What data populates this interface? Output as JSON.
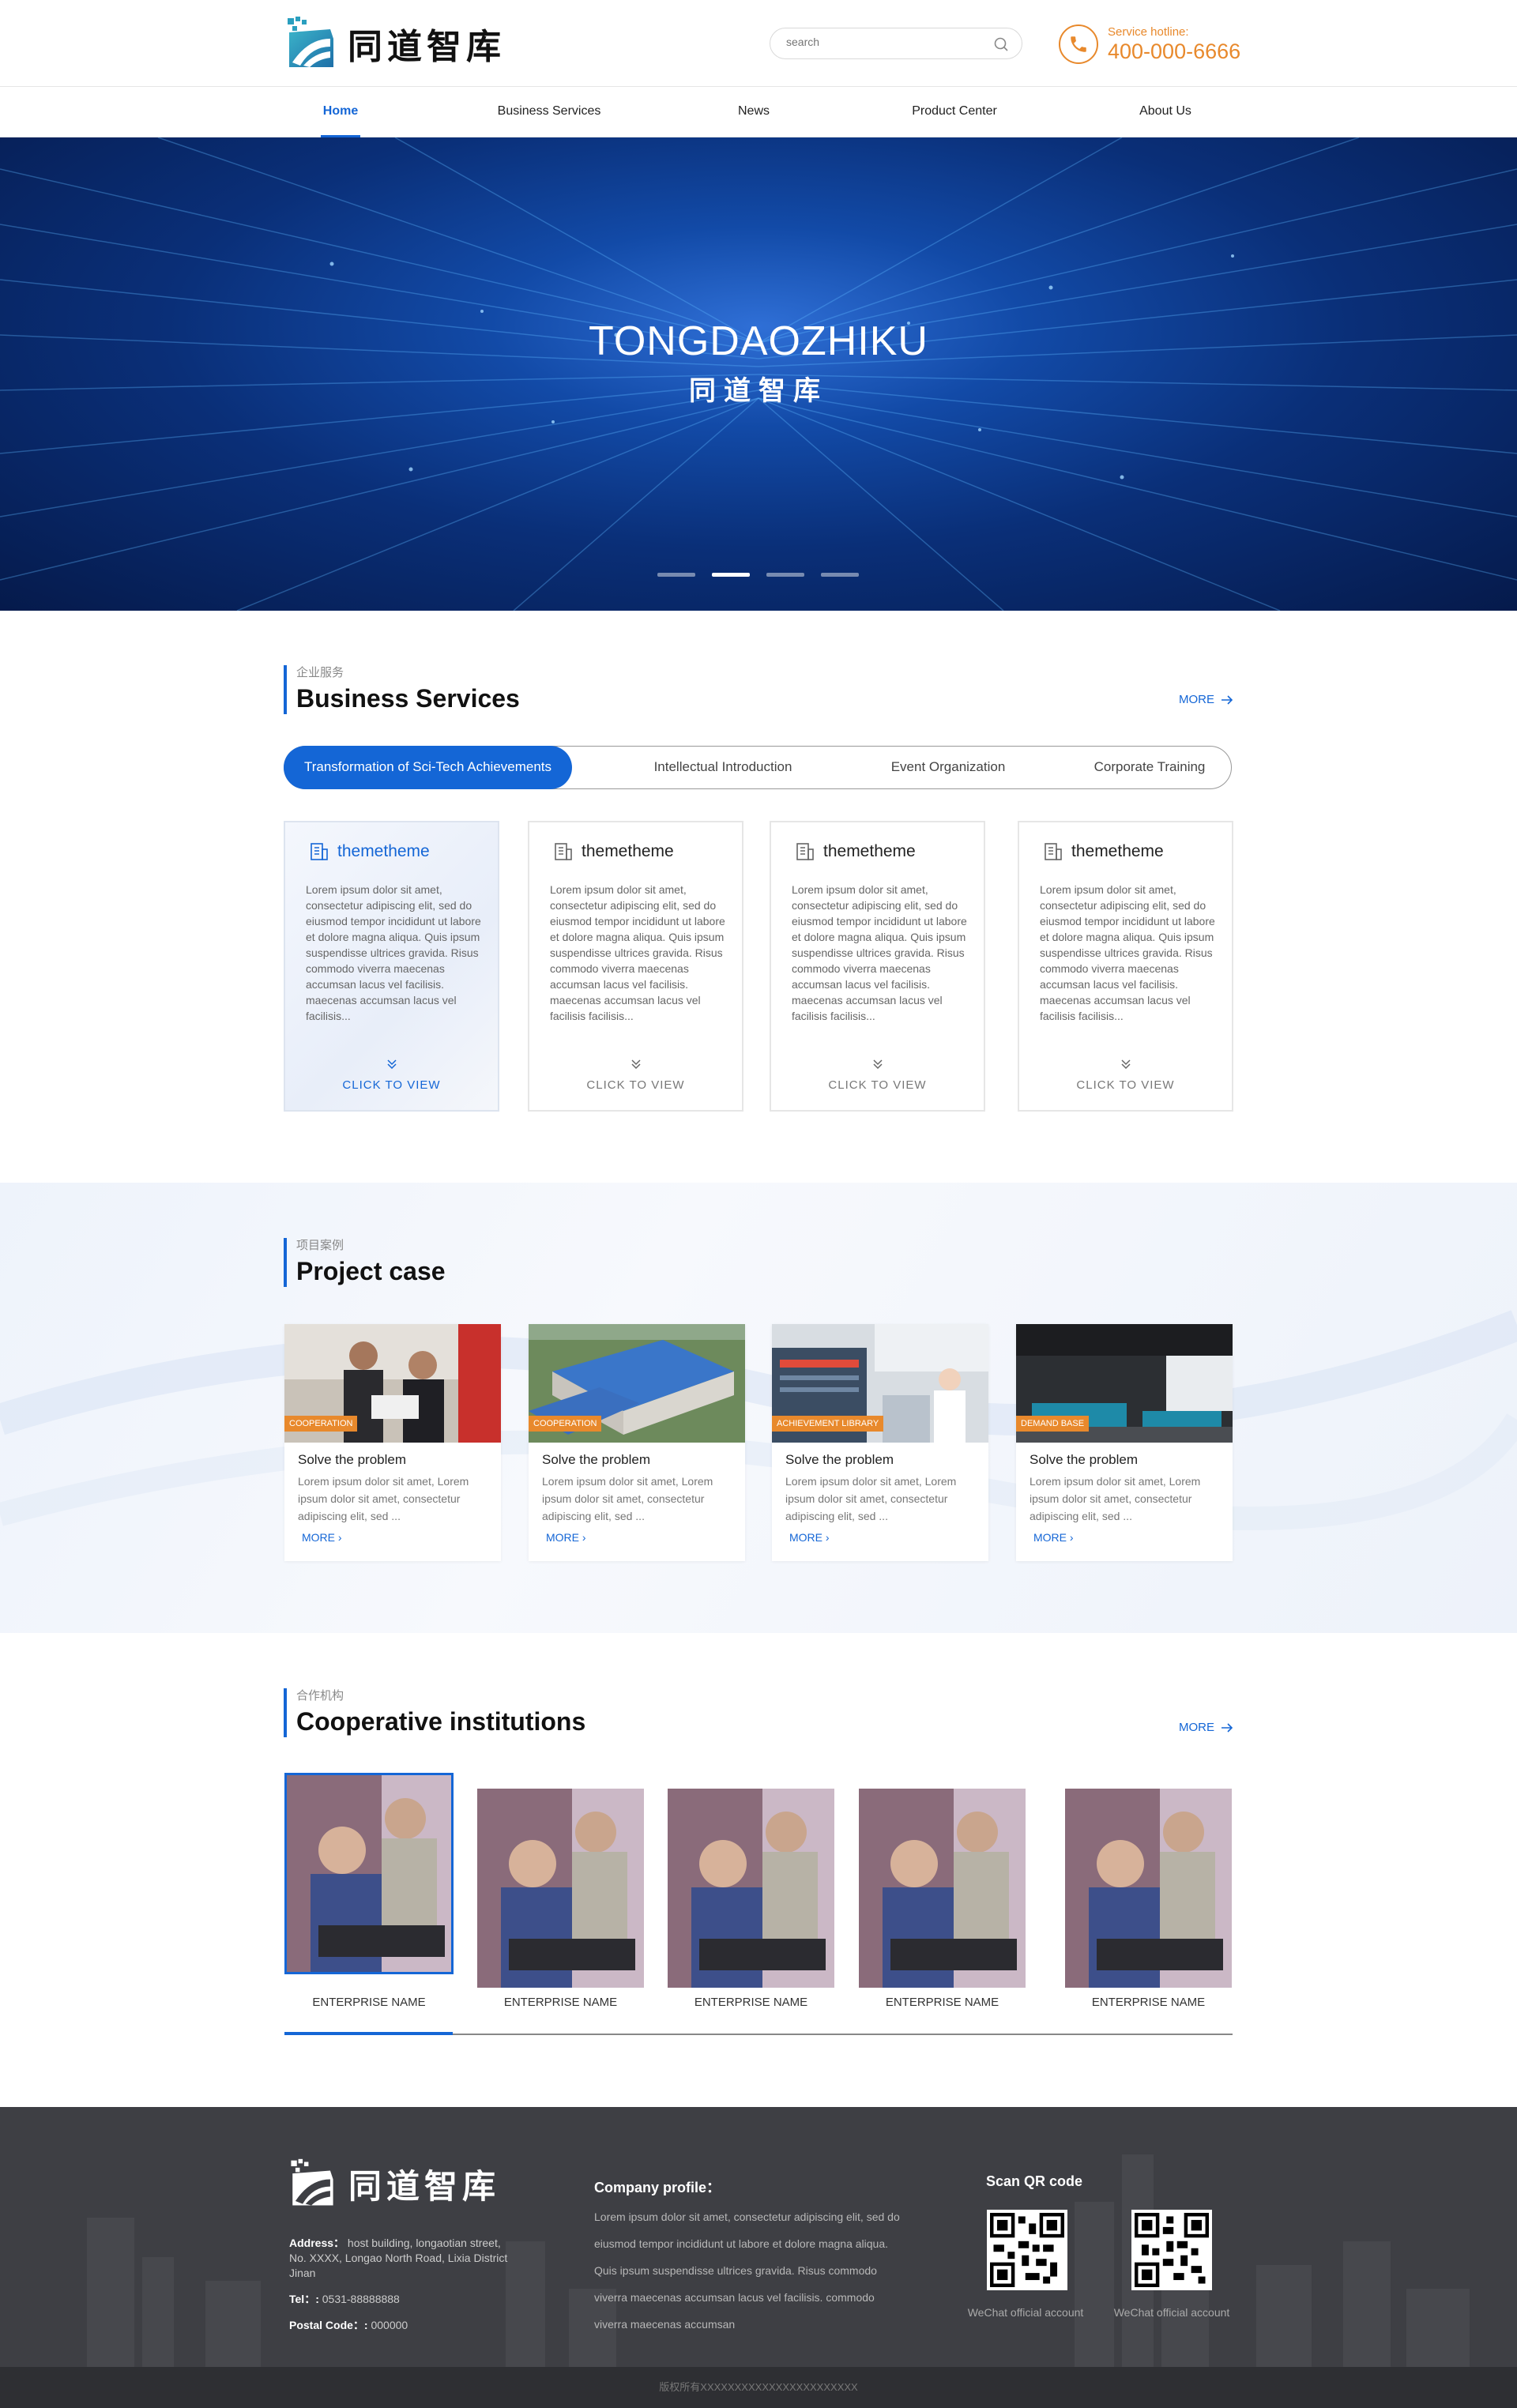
{
  "brand": {
    "name_cn": "同道智库",
    "banner_title": "TONGDAOZHIKU"
  },
  "header": {
    "search_placeholder": "search",
    "hotline_label": "Service hotline:",
    "hotline_number": "400-000-6666"
  },
  "nav": {
    "items": [
      {
        "label": "Home",
        "active": true
      },
      {
        "label": "Business Services",
        "active": false
      },
      {
        "label": "News",
        "active": false
      },
      {
        "label": "Product Center",
        "active": false
      },
      {
        "label": "About Us",
        "active": false
      }
    ]
  },
  "banner": {
    "slide_count": 4,
    "active_slide": 2
  },
  "services": {
    "label_cn": "企业服务",
    "title": "Business Services",
    "more": "MORE",
    "tabs": [
      {
        "label": "Transformation of Sci-Tech Achievements",
        "active": true
      },
      {
        "label": "Intellectual Introduction",
        "active": false
      },
      {
        "label": "Event Organization",
        "active": false
      },
      {
        "label": "Corporate Training",
        "active": false
      }
    ],
    "cards": [
      {
        "title": "themetheme",
        "desc": "Lorem ipsum dolor sit amet, consectetur adipiscing elit, sed do eiusmod tempor incididunt ut labore et dolore magna aliqua. Quis ipsum suspendisse ultrices gravida. Risus commodo viverra maecenas accumsan lacus vel facilisis. maecenas accumsan lacus vel facilisis...",
        "cta": "CLICK TO VIEW",
        "active": true
      },
      {
        "title": "themetheme",
        "desc": "Lorem ipsum dolor sit amet, consectetur adipiscing elit, sed do eiusmod tempor incididunt ut labore et dolore magna aliqua. Quis ipsum suspendisse ultrices gravida. Risus commodo viverra maecenas accumsan lacus vel facilisis.  maecenas accumsan lacus vel facilisis facilisis...",
        "cta": "CLICK TO VIEW",
        "active": false
      },
      {
        "title": "themetheme",
        "desc": "Lorem ipsum dolor sit amet, consectetur adipiscing elit, sed do eiusmod tempor incididunt ut labore et dolore magna aliqua. Quis ipsum suspendisse ultrices gravida. Risus commodo viverra maecenas accumsan lacus vel facilisis.  maecenas accumsan lacus vel facilisis facilisis...",
        "cta": "CLICK TO VIEW",
        "active": false
      },
      {
        "title": "themetheme",
        "desc": "Lorem ipsum dolor sit amet, consectetur adipiscing elit, sed do eiusmod tempor incididunt ut labore et dolore magna aliqua. Quis ipsum suspendisse ultrices gravida. Risus commodo viverra maecenas accumsan lacus vel facilisis.  maecenas accumsan lacus vel facilisis facilisis...",
        "cta": "CLICK TO VIEW",
        "active": false
      }
    ]
  },
  "projects": {
    "label_cn": "项目案例",
    "title": "Project case",
    "items": [
      {
        "tag": "COOPERATION",
        "title": "Solve the problem",
        "desc": "Lorem ipsum dolor sit amet, Lorem ipsum dolor sit amet, consectetur adipiscing elit, sed  ...",
        "more": "MORE"
      },
      {
        "tag": "COOPERATION",
        "title": "Solve the problem",
        "desc": "Lorem ipsum dolor sit amet, Lorem ipsum dolor sit amet, consectetur adipiscing elit, sed  ...",
        "more": "MORE"
      },
      {
        "tag": "ACHIEVEMENT LIBRARY",
        "title": "Solve the problem",
        "desc": "Lorem ipsum dolor sit amet, Lorem ipsum dolor sit amet, consectetur adipiscing elit, sed  ...",
        "more": "MORE"
      },
      {
        "tag": "DEMAND BASE",
        "title": "Solve the problem",
        "desc": "Lorem ipsum dolor sit amet, Lorem ipsum dolor sit amet, consectetur adipiscing elit, sed  ...",
        "more": "MORE"
      }
    ]
  },
  "cooperation": {
    "label_cn": "合作机构",
    "title": "Cooperative institutions",
    "more": "MORE",
    "items": [
      {
        "name": "ENTERPRISE NAME",
        "active": true
      },
      {
        "name": "ENTERPRISE NAME",
        "active": false
      },
      {
        "name": "ENTERPRISE NAME",
        "active": false
      },
      {
        "name": "ENTERPRISE NAME",
        "active": false
      },
      {
        "name": "ENTERPRISE NAME",
        "active": false
      }
    ]
  },
  "footer": {
    "address_label": "Address：",
    "address": "host building, longaotian street, No. XXXX, Longao North Road, Lixia District Jinan",
    "tel_label": "Tel：:",
    "tel": "0531-88888888",
    "postal_label": "Postal Code：:",
    "postal": "000000",
    "profile_title": "Company profile：",
    "profile": "Lorem ipsum dolor sit amet, consectetur adipiscing elit, sed do eiusmod tempor incididunt ut labore et dolore magna aliqua. Quis ipsum suspendisse ultrices gravida. Risus commodo viverra maecenas accumsan lacus vel facilisis. commodo viverra maecenas accumsan",
    "qr_title": "Scan QR code",
    "qr_labels": [
      "WeChat official account",
      "WeChat official account"
    ],
    "copyright": "版权所有XXXXXXXXXXXXXXXXXXXXXXX"
  },
  "colors": {
    "accent": "#1466d6",
    "orange": "#e8892c",
    "footer_bg": "#3e3f44"
  }
}
